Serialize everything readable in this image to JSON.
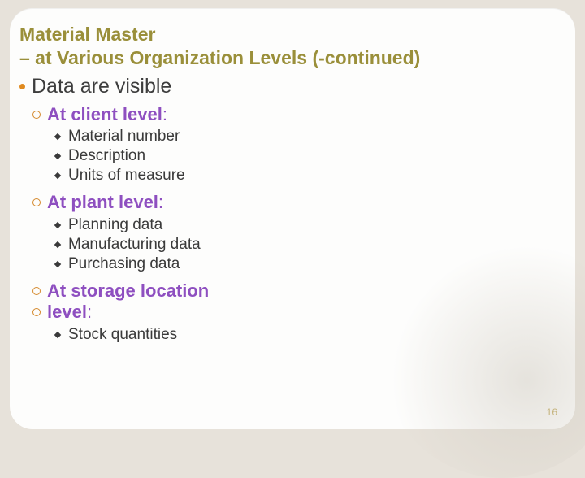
{
  "title_line1": "Material Master",
  "title_line2": "– at Various Organization Levels (-continued)",
  "top": "Data are visible",
  "sections": [
    {
      "head_bold": "At client level",
      "head_tail": ":",
      "items": [
        "Material number",
        "Description",
        "Units of measure"
      ]
    },
    {
      "head_bold": "At plant level",
      "head_tail": ":",
      "items": [
        "Planning data",
        "Manufacturing data",
        "Purchasing data"
      ]
    },
    {
      "head_bold": "At storage location",
      "head_tail": ""
    },
    {
      "head_bold": "level",
      "head_tail": ":",
      "items": [
        "Stock quantities"
      ]
    }
  ],
  "page_number": "16"
}
